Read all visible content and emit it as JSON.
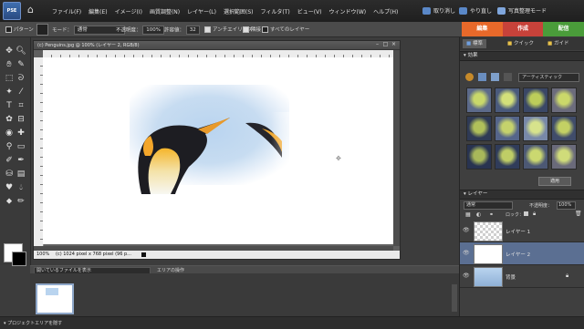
{
  "app": {
    "logo_text": "PSE"
  },
  "menu": [
    "ファイル(F)",
    "編集(E)",
    "イメージ(I)",
    "画質調整(N)",
    "レイヤー(L)",
    "選択範囲(S)",
    "フィルタ(T)",
    "ビュー(V)",
    "ウィンドウ(W)",
    "ヘルプ(H)"
  ],
  "menubar_right": {
    "undo": "取り消し",
    "redo": "やり直し",
    "organizer": "写真整理モード"
  },
  "options": {
    "pattern_label": "パターン",
    "mode_label": "モード：",
    "mode_value": "通常",
    "opacity_label": "不透明度：",
    "opacity_value": "100%",
    "tolerance_label": "許容値：",
    "tolerance_value": "32",
    "antialias": "アンチエイリアス",
    "contiguous": "隣接",
    "all_layers": "すべてのレイヤー"
  },
  "mode_tabs": [
    {
      "label": "編集",
      "color": "#e8692a"
    },
    {
      "label": "作成",
      "color": "#c7423a"
    },
    {
      "label": "配信",
      "color": "#4a9c3a"
    }
  ],
  "document": {
    "title": "(c) Penguins.jpg @ 100% (レイヤー 2, RGB/8)",
    "zoom": "100%",
    "info": "(c) 1024 pixel x 768 pixel (96 p..."
  },
  "project_bin": {
    "dropdown": "開いているファイルを表示",
    "actions_label": "エリアの操作",
    "hide_label": "プロジェクトエリアを隠す"
  },
  "right_panel": {
    "tabs": [
      "標準",
      "クイック",
      "ガイド"
    ],
    "effects_title": "効果",
    "effects_dropdown": "アーティスティック",
    "apply_button": "適用",
    "layers_title": "レイヤー",
    "blend_mode": "通常",
    "opacity_label": "不透明度：",
    "opacity_value": "100%",
    "lock_label": "ロック：",
    "layers": [
      {
        "name": "レイヤー 1"
      },
      {
        "name": "レイヤー 2"
      },
      {
        "name": "背景"
      }
    ]
  }
}
